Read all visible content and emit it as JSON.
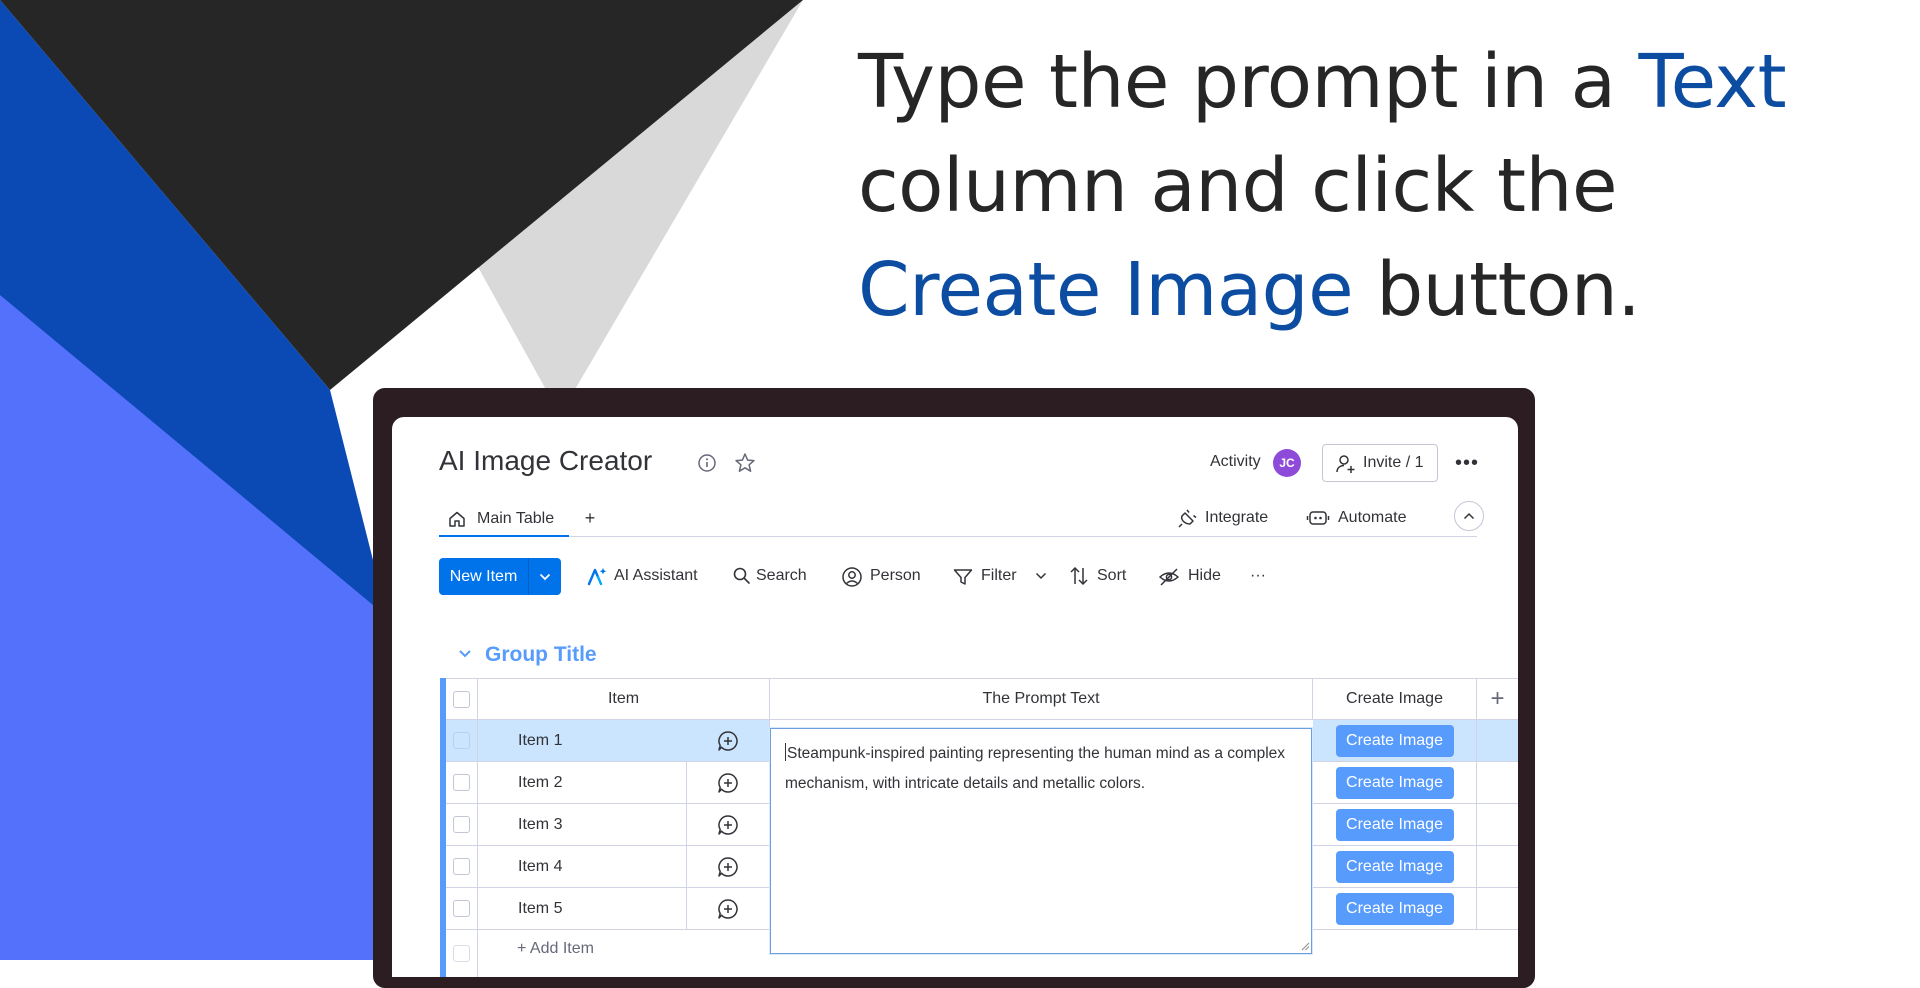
{
  "headline": {
    "part1": "Type the prompt in a ",
    "accent1": "Text",
    "part2": "column and click the",
    "accent2": "Create Image",
    "part3": " button."
  },
  "colors": {
    "accent_text": "#0c4da2",
    "bg_dark": "#262626",
    "bg_blue_dark": "#0b49b4",
    "bg_blue_light": "#5471fb",
    "bg_gray": "#d9d9d9",
    "primary_button": "#0073ea",
    "create_image_button": "#579bfc",
    "avatar": "#8e4bd9"
  },
  "app": {
    "board_title": "AI Image Creator",
    "activity_label": "Activity",
    "avatar_initials": "JC",
    "invite_label": "Invite / 1",
    "more_label": "•••",
    "tabs": [
      {
        "label": "Main Table",
        "active": true,
        "icon": "home-icon"
      }
    ],
    "add_tab_label": "+",
    "integrate_label": "Integrate",
    "automate_label": "Automate",
    "toolbar": {
      "new_item_label": "New Item",
      "ai_assistant_label": "AI Assistant",
      "search_label": "Search",
      "person_label": "Person",
      "filter_label": "Filter",
      "sort_label": "Sort",
      "hide_label": "Hide",
      "more_label": "···"
    },
    "group": {
      "title": "Group Title",
      "columns": [
        "Item",
        "The Prompt Text",
        "Create Image"
      ],
      "add_column_label": "+",
      "rows": [
        {
          "name": "Item 1",
          "button": "Create Image",
          "selected": true
        },
        {
          "name": "Item 2",
          "button": "Create Image",
          "selected": false
        },
        {
          "name": "Item 3",
          "button": "Create Image",
          "selected": false
        },
        {
          "name": "Item 4",
          "button": "Create Image",
          "selected": false
        },
        {
          "name": "Item 5",
          "button": "Create Image",
          "selected": false
        }
      ],
      "add_item_label": "+ Add Item"
    },
    "prompt_editor": {
      "value": "Steampunk-inspired painting representing the human mind as a complex mechanism, with intricate details and metallic colors."
    }
  }
}
